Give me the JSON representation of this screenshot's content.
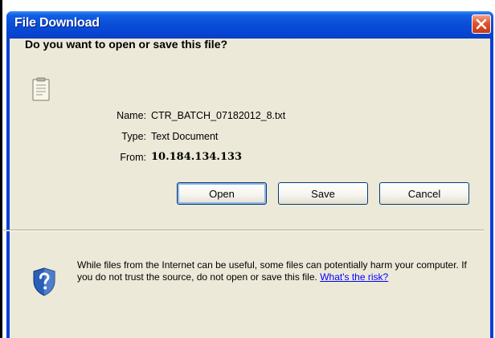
{
  "window": {
    "title": "File Download",
    "close_icon": "close-icon"
  },
  "question": "Do you want to open or save this file?",
  "file": {
    "icon": "text-file-icon",
    "name_label": "Name:",
    "name_value": "CTR_BATCH_07182012_8.txt",
    "type_label": "Type:",
    "type_value": "Text Document",
    "from_label": "From:",
    "from_value": "10.184.134.133"
  },
  "buttons": {
    "open": "Open",
    "save": "Save",
    "cancel": "Cancel"
  },
  "warning": {
    "icon": "shield-question-icon",
    "text": "While files from the Internet can be useful, some files can potentially harm your computer. If you do not trust the source, do not open or save this file.",
    "link": "What's the risk?"
  },
  "colors": {
    "titlebar": "#0a4fd8",
    "dialog_body": "#ece9d8",
    "close_button": "#e0532a",
    "link": "#0000ff"
  }
}
